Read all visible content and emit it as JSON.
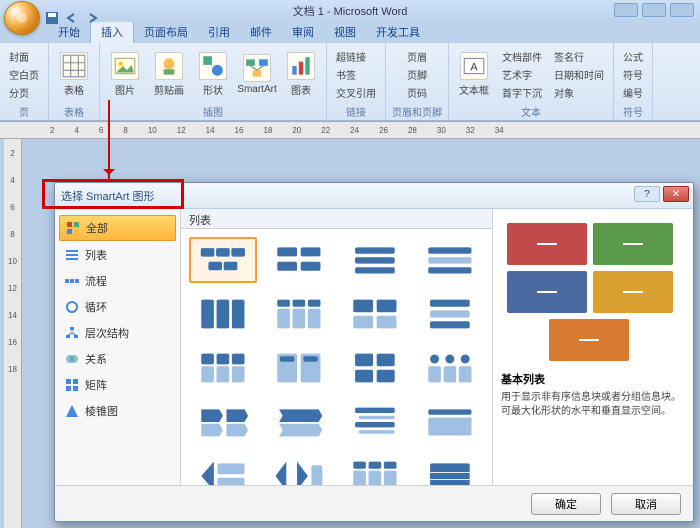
{
  "titlebar": {
    "title": "文档 1 - Microsoft Word"
  },
  "ribbon_tabs": [
    "开始",
    "插入",
    "页面布局",
    "引用",
    "邮件",
    "审阅",
    "视图",
    "开发工具"
  ],
  "active_tab_index": 1,
  "ribbon": {
    "g1": {
      "items": [
        "封面",
        "空白页",
        "分页"
      ],
      "label": "页"
    },
    "g2": {
      "item": "表格",
      "label": "表格"
    },
    "g3": {
      "items": [
        "图片",
        "剪贴画",
        "形状",
        "SmartArt",
        "图表"
      ],
      "label": "插图"
    },
    "g4": {
      "items": [
        "超链接",
        "书签",
        "交叉引用"
      ],
      "label": "链接"
    },
    "g5": {
      "items": [
        "页眉",
        "页脚",
        "页码"
      ],
      "label": "页眉和页脚"
    },
    "g6": {
      "big": "文本框",
      "small": [
        "文档部件",
        "艺术字",
        "首字下沉",
        "签名行",
        "日期和时间",
        "对象"
      ],
      "label": "文本"
    },
    "g7": {
      "items": [
        "公式",
        "符号",
        "编号"
      ],
      "label": "符号"
    }
  },
  "ruler_marks": [
    "2",
    "4",
    "6",
    "8",
    "10",
    "12",
    "14",
    "16",
    "18",
    "20",
    "22",
    "24",
    "26",
    "28",
    "30",
    "32",
    "34"
  ],
  "vruler_marks": [
    "2",
    "4",
    "6",
    "8",
    "10",
    "12",
    "14",
    "16",
    "18"
  ],
  "dialog": {
    "title": "选择 SmartArt 图形",
    "sidebar": [
      "全部",
      "列表",
      "流程",
      "循环",
      "层次结构",
      "关系",
      "矩阵",
      "棱锥图"
    ],
    "gallery_header": "列表",
    "preview": {
      "colors": [
        "#c24a4a",
        "#5a9a4a",
        "#4a6aa0",
        "#d8a030",
        "#d87a30"
      ],
      "title": "基本列表",
      "desc": "用于显示非有序信息块或者分组信息块。可最大化形状的水平和垂直显示空间。"
    },
    "ok": "确定",
    "cancel": "取消"
  }
}
